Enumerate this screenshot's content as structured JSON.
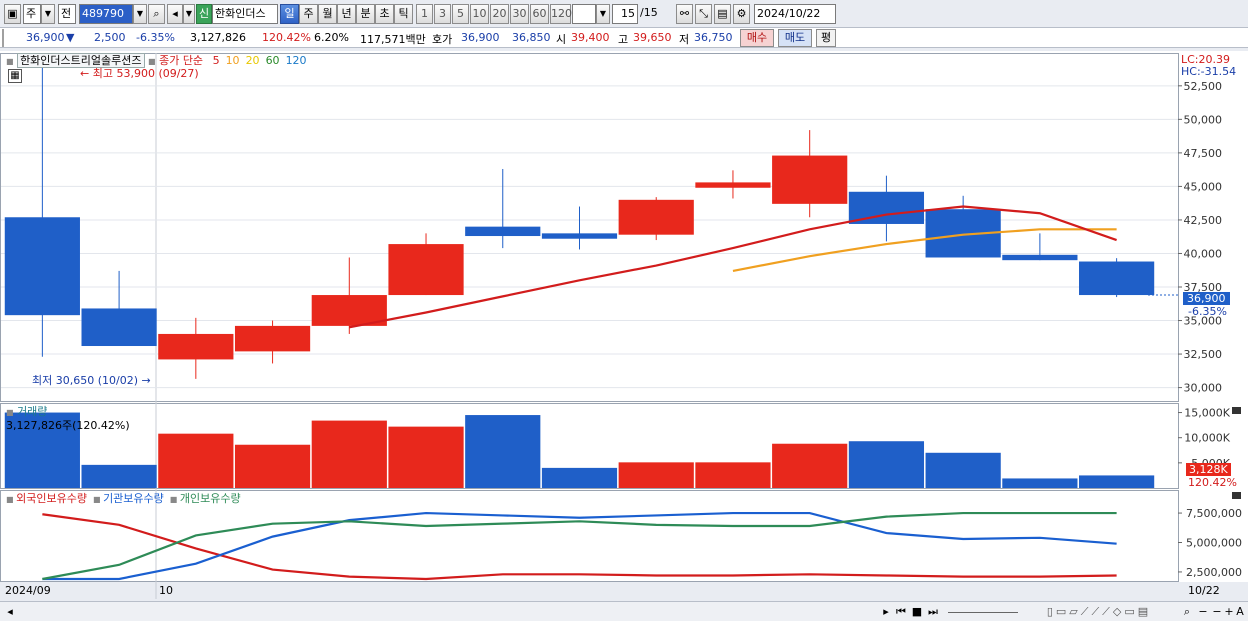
{
  "toolbar": {
    "period_select": "주",
    "prev_label": "전",
    "stock_code": "489790",
    "new_badge": "신",
    "stock_name": "한화인더스",
    "periods": [
      {
        "label": "일",
        "active": true
      },
      {
        "label": "주",
        "active": false
      },
      {
        "label": "월",
        "active": false
      },
      {
        "label": "년",
        "active": false
      },
      {
        "label": "분",
        "active": false
      },
      {
        "label": "초",
        "active": false
      },
      {
        "label": "틱",
        "active": false
      }
    ],
    "intervals": [
      "1",
      "3",
      "5",
      "10",
      "20",
      "30",
      "60",
      "120"
    ],
    "count": "15",
    "count_total": "/15",
    "date": "2024/10/22"
  },
  "quote": {
    "price": "36,900",
    "down_arrow": "▼",
    "change": "2,500",
    "change_pct": "-6.35%",
    "volume": "3,127,826",
    "volume_pct": "120.42%",
    "turnover": "6.20%",
    "amount": "117,571백만",
    "bid_label": "호가",
    "ask": "36,900",
    "bid": "36,850",
    "open_label": "시",
    "open": "39,400",
    "high_label": "고",
    "high": "39,650",
    "low_label": "저",
    "low": "36,750",
    "buy_label": "매수",
    "sell_label": "매도",
    "eval_label": "평"
  },
  "price_panel": {
    "title": "한화인더스트리얼솔루션즈",
    "ma_title": "종가 단순",
    "ma_periods": [
      {
        "label": "5",
        "color": "#d21c1c"
      },
      {
        "label": "10",
        "color": "#f0a020"
      },
      {
        "label": "20",
        "color": "#e8c800"
      },
      {
        "label": "60",
        "color": "#2a8a2a"
      },
      {
        "label": "120",
        "color": "#1a7ac8"
      }
    ],
    "high_note": "최고 53,900 (09/27)",
    "low_note": "최저 30,650 (10/02)",
    "lc": "LC:20.39",
    "hc": "HC:-31.54",
    "current_tag": "36,900",
    "current_pct": "-6.35%"
  },
  "volume_panel": {
    "title": "거래량",
    "summary": "3,127,826주(120.42%)",
    "current_tag": "3,128K",
    "current_pct": "120.42%"
  },
  "holding_panel": {
    "series": [
      {
        "label": "외국인보유수량",
        "color": "#d21c1c"
      },
      {
        "label": "기관보유수량",
        "color": "#1a5fd0"
      },
      {
        "label": "개인보유수량",
        "color": "#2e8b57"
      }
    ]
  },
  "x_axis": {
    "labels": [
      "2024/09",
      "10"
    ],
    "right_label": "10/22"
  },
  "colors": {
    "up": "#e8281c",
    "down": "#1f5fc8",
    "ma5": "#d21c1c",
    "ma10": "#f0a020"
  },
  "chart_data": [
    {
      "type": "candlestick",
      "title": "한화인더스트리얼솔루션즈",
      "ylim": [
        29000,
        54500
      ],
      "y_ticks": [
        30000,
        32500,
        35000,
        37500,
        40000,
        42500,
        45000,
        47500,
        50000,
        52500
      ],
      "y_tick_labels": [
        "30,000",
        "32,500",
        "35,000",
        "37,500",
        "40,000",
        "42,500",
        "45,000",
        "47,500",
        "50,000",
        "52,500"
      ],
      "candles": [
        {
          "o": 42700,
          "h": 53900,
          "l": 32300,
          "c": 35400
        },
        {
          "o": 35900,
          "h": 38700,
          "l": 33100,
          "c": 33100
        },
        {
          "o": 32100,
          "h": 35200,
          "l": 30650,
          "c": 34000
        },
        {
          "o": 32700,
          "h": 35000,
          "l": 31800,
          "c": 34600
        },
        {
          "o": 34600,
          "h": 39700,
          "l": 34000,
          "c": 36900
        },
        {
          "o": 36900,
          "h": 41500,
          "l": 36900,
          "c": 40700
        },
        {
          "o": 42000,
          "h": 46300,
          "l": 40400,
          "c": 41300
        },
        {
          "o": 41500,
          "h": 43500,
          "l": 40300,
          "c": 41100
        },
        {
          "o": 41400,
          "h": 44200,
          "l": 41000,
          "c": 44000
        },
        {
          "o": 44900,
          "h": 46200,
          "l": 44100,
          "c": 45300
        },
        {
          "o": 43700,
          "h": 49200,
          "l": 42700,
          "c": 47300
        },
        {
          "o": 44600,
          "h": 45800,
          "l": 40900,
          "c": 42200
        },
        {
          "o": 43300,
          "h": 44300,
          "l": 39700,
          "c": 39700
        },
        {
          "o": 39900,
          "h": 41500,
          "l": 39500,
          "c": 39500
        },
        {
          "o": 39400,
          "h": 39650,
          "l": 36750,
          "c": 36900
        }
      ],
      "ma5": [
        null,
        null,
        null,
        null,
        34500,
        35600,
        36800,
        38000,
        39100,
        40400,
        41800,
        42900,
        43500,
        43000,
        41000
      ],
      "ma10": [
        null,
        null,
        null,
        null,
        null,
        null,
        null,
        null,
        null,
        38700,
        39800,
        40700,
        41400,
        41800,
        41800
      ]
    },
    {
      "type": "bar",
      "title": "거래량",
      "ylim": [
        0,
        16500
      ],
      "y_ticks": [
        5000,
        10000,
        15000
      ],
      "y_tick_labels": [
        "5,000K",
        "10,000K",
        "15,000K"
      ],
      "values": [
        15000,
        4600,
        10800,
        8600,
        13400,
        12200,
        14500,
        4000,
        5100,
        5100,
        8800,
        9300,
        7000,
        1900,
        2500
      ],
      "directions": [
        "down",
        "down",
        "up",
        "up",
        "up",
        "up",
        "down",
        "down",
        "up",
        "up",
        "up",
        "down",
        "down",
        "down",
        "down"
      ]
    },
    {
      "type": "line",
      "ylim": [
        1900000,
        8100000
      ],
      "y_ticks": [
        2500000,
        5000000,
        7500000
      ],
      "y_tick_labels": [
        "2,500,000",
        "5,000,000",
        "7,500,000"
      ],
      "series": [
        {
          "name": "외국인보유수량",
          "values": [
            7400000,
            6500000,
            4500000,
            2700000,
            2100000,
            1900000,
            2300000,
            2300000,
            2200000,
            2200000,
            2300000,
            2200000,
            2100000,
            2100000,
            2200000
          ]
        },
        {
          "name": "기관보유수량",
          "values": [
            1900000,
            1900000,
            3200000,
            5500000,
            6900000,
            7500000,
            7300000,
            7100000,
            7300000,
            7500000,
            7500000,
            5800000,
            5300000,
            5400000,
            4900000
          ]
        },
        {
          "name": "개인보유수량",
          "values": [
            1900000,
            3100000,
            5600000,
            6600000,
            6800000,
            6400000,
            6600000,
            6800000,
            6500000,
            6400000,
            6400000,
            7200000,
            7500000,
            7500000,
            7500000
          ]
        }
      ]
    }
  ]
}
